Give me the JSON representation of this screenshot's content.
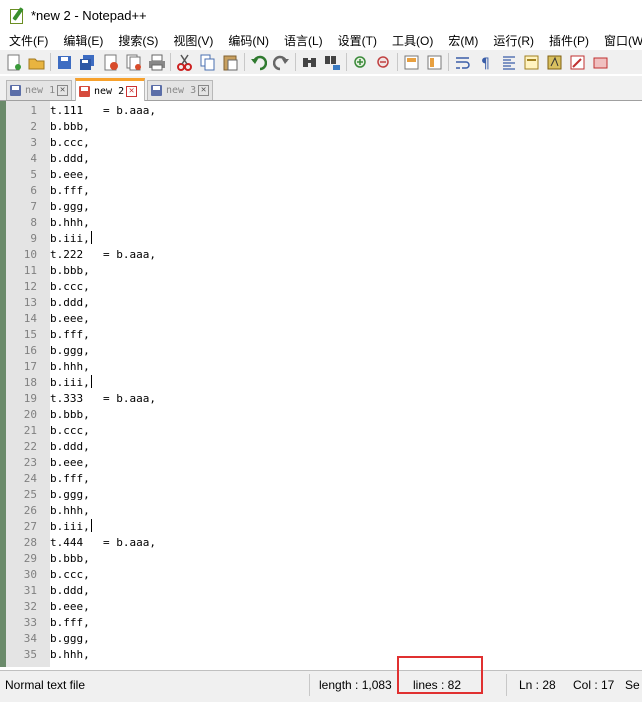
{
  "window": {
    "title": "*new 2 - Notepad++"
  },
  "menu": [
    "文件(F)",
    "编辑(E)",
    "搜索(S)",
    "视图(V)",
    "编码(N)",
    "语言(L)",
    "设置(T)",
    "工具(O)",
    "宏(M)",
    "运行(R)",
    "插件(P)",
    "窗口(W)"
  ],
  "toolbar": {
    "buttons": [
      "new-file-icon",
      "open-file-icon",
      "save-icon",
      "save-all-icon",
      "close-icon",
      "close-all-icon",
      "print-icon",
      "cut-icon",
      "copy-icon",
      "paste-icon",
      "undo-icon",
      "redo-icon",
      "find-icon",
      "replace-icon",
      "zoom-in-icon",
      "zoom-out-icon",
      "sync-vertical-icon",
      "sync-horizontal-icon",
      "word-wrap-icon",
      "show-all-chars-icon",
      "indent-guide-icon",
      "doc-map-icon",
      "function-list-icon",
      "folder-as-workspace-icon",
      "record-macro-icon"
    ]
  },
  "tabs": [
    {
      "label": "new 1",
      "active": false
    },
    {
      "label": "new 2",
      "active": true
    },
    {
      "label": "new 3",
      "active": false
    }
  ],
  "editor": {
    "lines": [
      {
        "n": "1",
        "text": "t.111   = b.aaa,"
      },
      {
        "n": "2",
        "text": "b.bbb,"
      },
      {
        "n": "3",
        "text": "b.ccc,"
      },
      {
        "n": "4",
        "text": "b.ddd,"
      },
      {
        "n": "5",
        "text": "b.eee,"
      },
      {
        "n": "6",
        "text": "b.fff,"
      },
      {
        "n": "7",
        "text": "b.ggg,"
      },
      {
        "n": "8",
        "text": "b.hhh,"
      },
      {
        "n": "9",
        "text": "b.iii,",
        "caret": true
      },
      {
        "n": "10",
        "text": "t.222   = b.aaa,"
      },
      {
        "n": "11",
        "text": "b.bbb,"
      },
      {
        "n": "12",
        "text": "b.ccc,"
      },
      {
        "n": "13",
        "text": "b.ddd,"
      },
      {
        "n": "14",
        "text": "b.eee,"
      },
      {
        "n": "15",
        "text": "b.fff,"
      },
      {
        "n": "16",
        "text": "b.ggg,"
      },
      {
        "n": "17",
        "text": "b.hhh,"
      },
      {
        "n": "18",
        "text": "b.iii,",
        "caret": true
      },
      {
        "n": "19",
        "text": "t.333   = b.aaa,"
      },
      {
        "n": "20",
        "text": "b.bbb,"
      },
      {
        "n": "21",
        "text": "b.ccc,"
      },
      {
        "n": "22",
        "text": "b.ddd,"
      },
      {
        "n": "23",
        "text": "b.eee,"
      },
      {
        "n": "24",
        "text": "b.fff,"
      },
      {
        "n": "25",
        "text": "b.ggg,"
      },
      {
        "n": "26",
        "text": "b.hhh,"
      },
      {
        "n": "27",
        "text": "b.iii,",
        "caret": true
      },
      {
        "n": "28",
        "text": "t.444   = b.aaa,"
      },
      {
        "n": "29",
        "text": "b.bbb,"
      },
      {
        "n": "30",
        "text": "b.ccc,"
      },
      {
        "n": "31",
        "text": "b.ddd,"
      },
      {
        "n": "32",
        "text": "b.eee,"
      },
      {
        "n": "33",
        "text": "b.fff,"
      },
      {
        "n": "34",
        "text": "b.ggg,"
      },
      {
        "n": "35",
        "text": "b.hhh,"
      }
    ]
  },
  "status": {
    "file_type": "Normal text file",
    "length": "length : 1,083",
    "lines": "lines : 82",
    "ln": "Ln : 28",
    "col": "Col : 17",
    "sel": "Se"
  },
  "colors": {
    "active_tab_accent": "#f7a12c",
    "highlight_box": "#e03030",
    "gutter": "#e4e4e4"
  }
}
